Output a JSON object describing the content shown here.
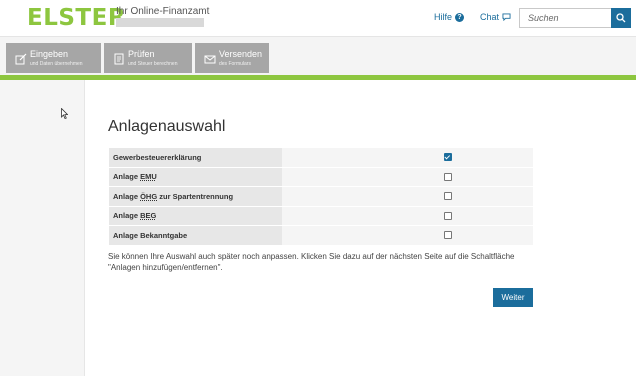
{
  "header": {
    "logo": "ELSTER",
    "tagline": "Ihr Online-Finanzamt",
    "help_label": "Hilfe",
    "chat_label": "Chat",
    "search_placeholder": "Suchen"
  },
  "nav": {
    "items": [
      {
        "title": "Eingeben",
        "subtitle": "und Daten übernehmen",
        "icon": "edit-icon"
      },
      {
        "title": "Prüfen",
        "subtitle": "und Steuer berechnen",
        "icon": "check-document-icon"
      },
      {
        "title": "Versenden",
        "subtitle": "des Formulars",
        "icon": "envelope-icon"
      }
    ]
  },
  "main": {
    "title": "Anlagenauswahl",
    "rows": [
      {
        "label": "Gewerbesteuererklärung",
        "checked": true
      },
      {
        "label_prefix": "Anlage ",
        "abbr": "EMU",
        "label_suffix": "",
        "checked": false
      },
      {
        "label_prefix": "Anlage ",
        "abbr": "ÖHG",
        "label_suffix": " zur Spartentrennung",
        "checked": false
      },
      {
        "label_prefix": "Anlage ",
        "abbr": "BEG",
        "label_suffix": "",
        "checked": false
      },
      {
        "label": "Anlage Bekanntgabe",
        "checked": false
      }
    ],
    "note": "Sie können Ihre Auswahl auch später noch anpassen. Klicken Sie dazu auf der nächsten Seite auf die Schaltfläche \"Anlagen hinzufügen/entfernen\".",
    "next_button": "Weiter"
  },
  "colors": {
    "brand_green": "#8dc63f",
    "accent_blue": "#1b6d9c",
    "nav_gray": "#a6a6a6"
  }
}
